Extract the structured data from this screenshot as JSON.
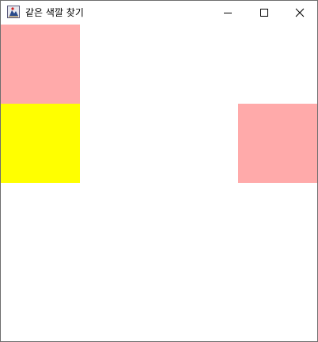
{
  "window": {
    "title": "같은 색깔 찾기",
    "controls": {
      "minimize": "minimize-icon",
      "maximize": "maximize-icon",
      "close": "close-icon"
    }
  },
  "board": {
    "grid": "4x4",
    "cells": [
      {
        "row": 0,
        "col": 0,
        "color": "#ffaaaa"
      },
      {
        "row": 1,
        "col": 0,
        "color": "#ffff00"
      },
      {
        "row": 1,
        "col": 3,
        "color": "#ffaaaa"
      }
    ],
    "background": "#ffffff"
  }
}
